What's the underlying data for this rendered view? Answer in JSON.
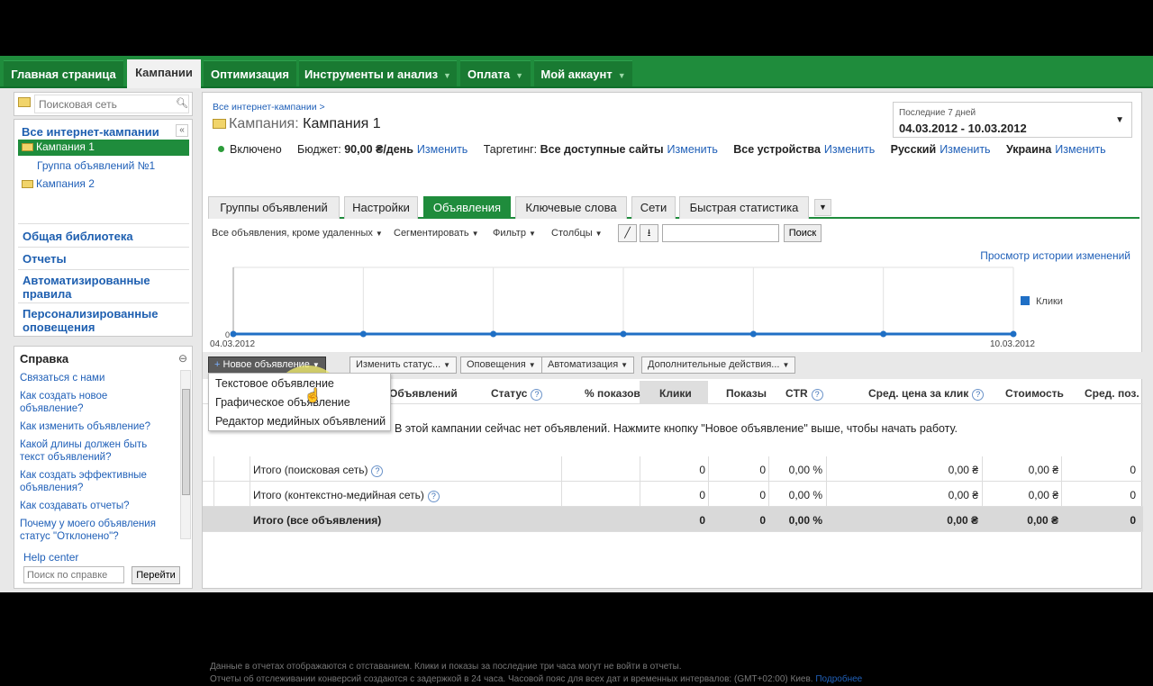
{
  "topnav": {
    "items": [
      {
        "label": "Главная страница"
      },
      {
        "label": "Кампании"
      },
      {
        "label": "Оптимизация"
      },
      {
        "label": "Инструменты и анализ"
      },
      {
        "label": "Оплата"
      },
      {
        "label": "Мой аккаунт"
      }
    ],
    "caret": "▼"
  },
  "sidebar": {
    "search_placeholder": "Поисковая сеть",
    "collapse": "«",
    "tree": {
      "all": "Все интернет-кампании",
      "campaign1": "Кампания 1",
      "adgroup1": "Группа объявлений №1",
      "campaign2": "Кампания 2"
    },
    "links": [
      "Общая библиотека",
      "Отчеты",
      "Автоматизированные правила",
      "Персонализированные оповещения"
    ],
    "help": {
      "title": "Справка",
      "collapse": "⊖",
      "items": [
        "Связаться с нами",
        "Как создать новое объявление?",
        "Как изменить объявление?",
        "Какой длины должен быть текст объявлений?",
        "Как создать эффективные объявления?",
        "Как создавать отчеты?",
        "Почему у моего объявления статус \"Отклонено\"?"
      ],
      "help_center": "Help center",
      "search_placeholder": "Поиск по справке",
      "go_button": "Перейти"
    }
  },
  "main": {
    "breadcrumb": "Все интернет-кампании >",
    "title_label": "Кампания:",
    "title_value": "Кампания 1",
    "date": {
      "label": "Последние 7 дней",
      "range": "04.03.2012 - 10.03.2012",
      "caret": "▼"
    },
    "info": {
      "status": "Включено",
      "budget_label": "Бюджет:",
      "budget_value": "90,00 ₴/день",
      "change": "Изменить",
      "targeting_label": "Таргетинг:",
      "targeting_value": "Все доступные сайты",
      "devices": "Все устройства",
      "language": "Русский",
      "country": "Украина"
    },
    "tabs": [
      "Группы объявлений",
      "Настройки",
      "Объявления",
      "Ключевые слова",
      "Сети",
      "Быстрая статистика"
    ],
    "tabs_more": "▼",
    "toolbar": {
      "filter_all": "Все объявления, кроме удаленных",
      "segment": "Сегментировать",
      "filter": "Фильтр",
      "columns": "Столбцы",
      "search_button": "Поиск"
    },
    "history_link": "Просмотр истории изменений",
    "actions": {
      "new_ad": "Новое объявление",
      "change_status": "Изменить статус...",
      "alerts": "Оповещения",
      "automation": "Автоматизация",
      "more_actions": "Дополнительные действия..."
    },
    "dropdown": [
      "Текстовое объявление",
      "Графическое объявление",
      "Редактор медийных объявлений"
    ],
    "table": {
      "headers": [
        "Объявлений",
        "Статус",
        "% показов",
        "Клики",
        "Показы",
        "CTR",
        "Сред. цена за клик",
        "Стоимость",
        "Сред. поз."
      ],
      "empty_message": "В этой кампании сейчас нет объявлений. Нажмите кнопку \"Новое объявление\" выше, чтобы начать работу.",
      "rows": [
        {
          "label": "Итого (поисковая сеть)",
          "clicks": "0",
          "impr": "0",
          "ctr": "0,00 %",
          "cpc": "0,00 ₴",
          "cost": "0,00 ₴",
          "pos": "0"
        },
        {
          "label": "Итого (контекстно-медийная сеть)",
          "clicks": "0",
          "impr": "0",
          "ctr": "0,00 %",
          "cpc": "0,00 ₴",
          "cost": "0,00 ₴",
          "pos": "0"
        },
        {
          "label": "Итого (все объявления)",
          "clicks": "0",
          "impr": "0",
          "ctr": "0,00 %",
          "cpc": "0,00 ₴",
          "cost": "0,00 ₴",
          "pos": "0"
        }
      ]
    },
    "footer": {
      "line1": "Данные в отчетах отображаются с отставанием. Клики и показы за последние три часа могут не войти в отчеты.",
      "line2": "Отчеты об отслеживании конверсий создаются с задержкой в 24 часа. Часовой пояс для всех дат и временных интервалов: (GMT+02:00) Киев.",
      "more": "Подробнее"
    }
  },
  "chart_data": {
    "type": "line",
    "x": [
      "04.03.2012",
      "05.03.2012",
      "06.03.2012",
      "07.03.2012",
      "08.03.2012",
      "09.03.2012",
      "10.03.2012"
    ],
    "x_tick_labels": [
      "04.03.2012",
      "10.03.2012"
    ],
    "series": [
      {
        "name": "Клики",
        "values": [
          0,
          0,
          0,
          0,
          0,
          0,
          0
        ]
      }
    ],
    "y_tick_labels": [
      "0"
    ],
    "color": "#1f6fc5",
    "legend": "right",
    "grid": true
  }
}
